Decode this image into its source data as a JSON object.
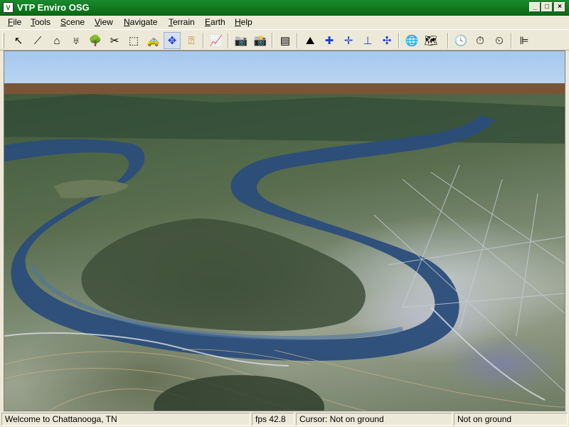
{
  "window": {
    "title": "VTP Enviro OSG"
  },
  "menu": [
    "File",
    "Tools",
    "Scene",
    "View",
    "Navigate",
    "Terrain",
    "Earth",
    "Help"
  ],
  "toolbar": {
    "buttons": [
      {
        "icon": "arrow-pointer-icon",
        "glyph": "↖"
      },
      {
        "icon": "fence-icon",
        "glyph": "⟋"
      },
      {
        "icon": "building-icon",
        "glyph": "⌂"
      },
      {
        "icon": "powerline-icon",
        "glyph": "♅"
      },
      {
        "icon": "tree-icon",
        "glyph": "🌳"
      },
      {
        "icon": "instance-icon",
        "glyph": "✂"
      },
      {
        "icon": "select-box-icon",
        "glyph": "⬚"
      },
      {
        "icon": "vehicle-icon",
        "glyph": "🚕"
      },
      {
        "icon": "move-icon",
        "glyph": "✥"
      },
      {
        "icon": "distance-icon",
        "glyph": "⍰"
      },
      {
        "icon": "profile-icon",
        "glyph": "📈"
      },
      {
        "icon": "camera-icon",
        "glyph": "📷"
      },
      {
        "icon": "camera-numbered-icon",
        "glyph": "📸"
      },
      {
        "icon": "layers-icon",
        "glyph": "▤"
      },
      {
        "icon": "terrain-icon",
        "glyph": "⛰"
      },
      {
        "icon": "fly-faster-icon",
        "glyph": "✚"
      },
      {
        "icon": "fly-slower-icon",
        "glyph": "✛"
      },
      {
        "icon": "ground-icon",
        "glyph": "⊥"
      },
      {
        "icon": "navigate-icon",
        "glyph": "✣"
      },
      {
        "icon": "globe-icon",
        "glyph": "🌐"
      },
      {
        "icon": "earth-map-icon",
        "glyph": "🗺"
      },
      {
        "icon": "clock-icon",
        "glyph": "🕓"
      },
      {
        "icon": "clock-play-icon",
        "glyph": "⏱"
      },
      {
        "icon": "clock-stop-icon",
        "glyph": "⏲"
      },
      {
        "icon": "scene-graph-icon",
        "glyph": "⊫"
      }
    ]
  },
  "status": {
    "message": "Welcome to Chattanooga, TN",
    "fps": "fps 42.8",
    "cursor": "Cursor: Not on ground",
    "ground": "Not on ground"
  }
}
